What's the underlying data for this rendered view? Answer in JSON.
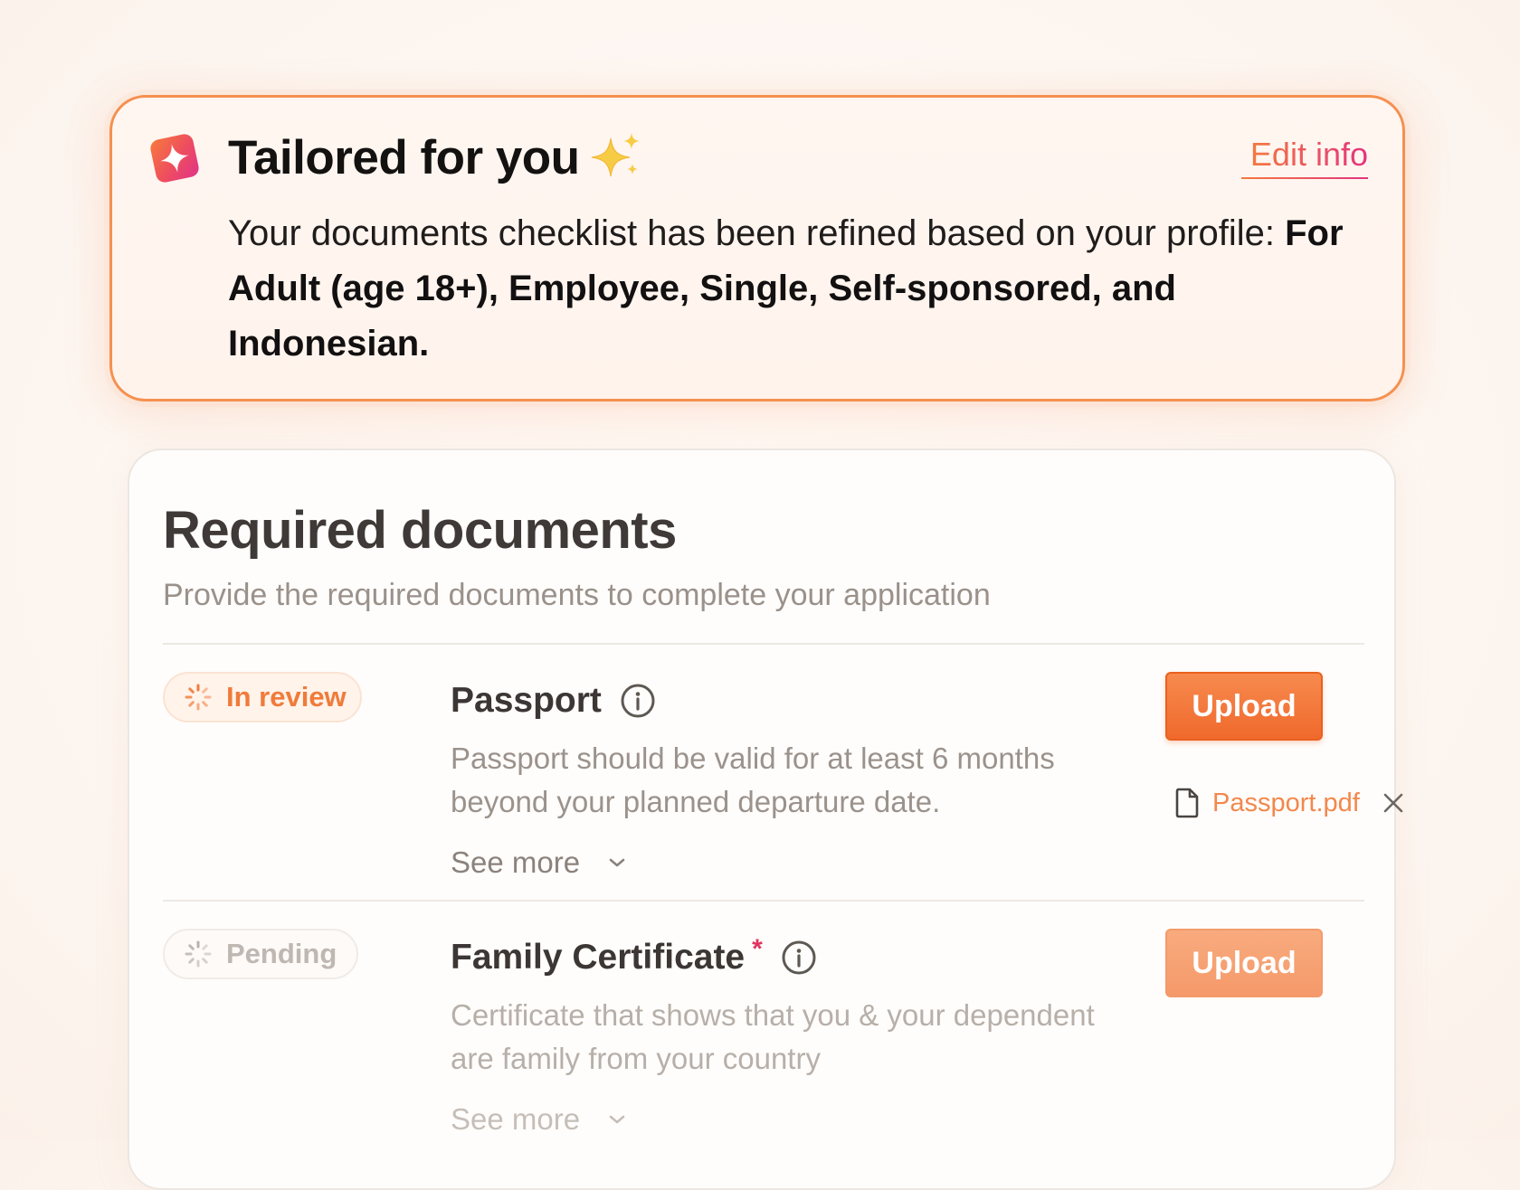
{
  "banner": {
    "title": "Tailored for you",
    "edit_label": "Edit info",
    "body_prefix": "Your documents checklist has been refined based on your profile: ",
    "body_highlight": "For Adult (age 18+), Employee, Single, Self-sponsored, and Indonesian.",
    "logo_icon": "sparkle-logo-icon",
    "title_icon": "sparkles-icon"
  },
  "card": {
    "title": "Required documents",
    "subtitle": "Provide the required documents to complete your application"
  },
  "documents": [
    {
      "status": "In review",
      "status_icon": "spinner-icon",
      "title": "Passport",
      "required": false,
      "description": "Passport should be valid for at least 6 months beyond your planned departure date.",
      "see_more": "See more",
      "upload_label": "Upload",
      "attached_file": "Passport.pdf"
    },
    {
      "status": "Pending",
      "status_icon": "spinner-icon",
      "title": "Family Certificate",
      "required": true,
      "required_mark": "*",
      "description": "Certificate that shows that you & your dependent are family from your country",
      "see_more": "See more",
      "upload_label": "Upload"
    }
  ],
  "colors": {
    "accent_orange": "#f0692c",
    "accent_pink": "#e3347f",
    "status_review": "#f07b3a",
    "status_pending": "#bfb7b1"
  }
}
